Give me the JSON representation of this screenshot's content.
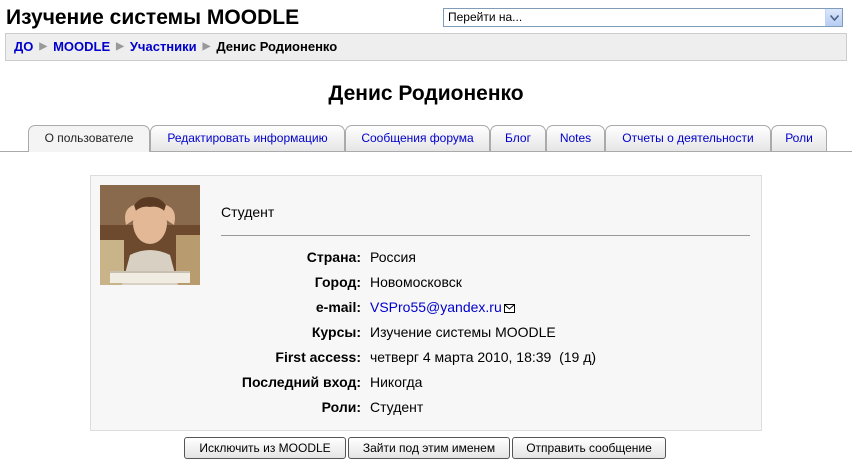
{
  "site": {
    "title": "Изучение системы MOODLE",
    "jump_menu": {
      "selected": "Перейти на..."
    }
  },
  "breadcrumb": {
    "items": [
      "ДО",
      "MOODLE",
      "Участники"
    ],
    "current": "Денис Родионенко"
  },
  "user": {
    "name": "Денис Родионенко"
  },
  "tabs": [
    {
      "label": "О пользователе",
      "selected": true
    },
    {
      "label": "Редактировать информацию"
    },
    {
      "label": "Сообщения форума"
    },
    {
      "label": "Блог"
    },
    {
      "label": "Notes"
    },
    {
      "label": "Отчеты о деятельности"
    },
    {
      "label": "Роли"
    }
  ],
  "profile": {
    "description": "Студент",
    "fields": [
      {
        "label": "Страна:",
        "value": "Россия"
      },
      {
        "label": "Город:",
        "value": "Новомосковск"
      },
      {
        "label": "e-mail:",
        "value": "VSPro55@yandex.ru"
      },
      {
        "label": "Курсы:",
        "value": "Изучение системы MOODLE"
      },
      {
        "label": "First access:",
        "value": "четверг 4 марта 2010, 18:39  (19 д)"
      },
      {
        "label": "Последний вход:",
        "value": "Никогда"
      },
      {
        "label": "Роли:",
        "value": "Студент"
      }
    ]
  },
  "actions": {
    "unenrol": "Исключить из MOODLE",
    "login_as": "Зайти под этим именем",
    "send_message": "Отправить сообщение"
  },
  "colors": {
    "link": "#0000cc",
    "navbar_bg": "#eeeeee",
    "box_bg": "#f7f7f7"
  }
}
